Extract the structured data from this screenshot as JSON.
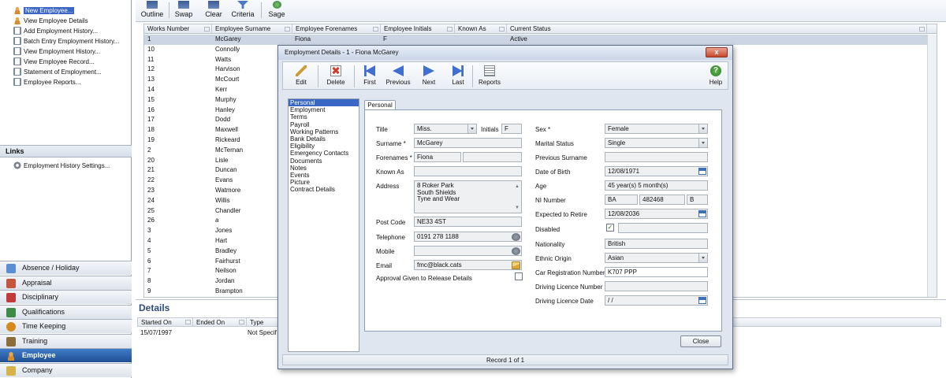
{
  "tasks": [
    "New Employee...",
    "View Employee Details",
    "Add Employment History...",
    "Batch Entry Employment History...",
    "View Employment History...",
    "View Employee Record...",
    "Statement of Employment...",
    "Employee Reports..."
  ],
  "links": {
    "header": "Links",
    "items": [
      "Employment History Settings..."
    ]
  },
  "modules": [
    {
      "label": "Absence / Holiday",
      "color": "#5b8fd1"
    },
    {
      "label": "Appraisal",
      "color": "#c2563e"
    },
    {
      "label": "Disciplinary",
      "color": "#c23b3b"
    },
    {
      "label": "Qualifications",
      "color": "#3f8b46"
    },
    {
      "label": "Time Keeping",
      "color": "#d48a1f"
    },
    {
      "label": "Training",
      "color": "#8c6d3c"
    },
    {
      "label": "Employee",
      "color": "#e8a84a"
    },
    {
      "label": "Company",
      "color": "#d7b14a"
    }
  ],
  "active_module": "Employee",
  "toolbar": {
    "outline": "Outline",
    "swap": "Swap",
    "clear": "Clear",
    "criteria": "Criteria",
    "sage": "Sage"
  },
  "grid": {
    "columns": [
      "Works Number",
      "Employee Surname",
      "Employee Forenames",
      "Employee Initials",
      "Known As",
      "Current Status"
    ],
    "first_row": {
      "number": "1",
      "surname": "McGarey",
      "forenames": "Fiona",
      "initials": "F",
      "status": "Active"
    },
    "rows": [
      [
        "10",
        "Connolly"
      ],
      [
        "11",
        "Watts"
      ],
      [
        "12",
        "Harvison"
      ],
      [
        "13",
        "McCourt"
      ],
      [
        "14",
        "Kerr"
      ],
      [
        "15",
        "Murphy"
      ],
      [
        "16",
        "Hanley"
      ],
      [
        "17",
        "Dodd"
      ],
      [
        "18",
        "Maxwell"
      ],
      [
        "19",
        "Rickeard"
      ],
      [
        "2",
        "McTernan"
      ],
      [
        "20",
        "Lisle"
      ],
      [
        "21",
        "Duncan"
      ],
      [
        "22",
        "Evans"
      ],
      [
        "23",
        "Watmore"
      ],
      [
        "24",
        "Willis"
      ],
      [
        "25",
        "Chandler"
      ],
      [
        "26",
        "a"
      ],
      [
        "3",
        "Jones"
      ],
      [
        "4",
        "Hart"
      ],
      [
        "5",
        "Bradley"
      ],
      [
        "6",
        "Fairhurst"
      ],
      [
        "7",
        "Neilson"
      ],
      [
        "8",
        "Jordan"
      ],
      [
        "9",
        "Brampton"
      ]
    ]
  },
  "details": {
    "title": "Details",
    "columns": [
      "Started On",
      "Ended On",
      "Type"
    ],
    "row": [
      "15/07/1997",
      "",
      "Not Specif"
    ]
  },
  "dialog": {
    "title": "Employment Details - 1 - Fiona McGarey",
    "close_glyph": "x",
    "tools": {
      "edit": "Edit",
      "delete": "Delete",
      "first": "First",
      "previous": "Previous",
      "next": "Next",
      "last": "Last",
      "reports": "Reports",
      "help": "Help"
    },
    "nav": [
      "Personal",
      "Employment",
      "Terms",
      "Payroll",
      "Working Patterns",
      "Bank Details",
      "Eligibility",
      "Emergency Contacts",
      "Documents",
      "Notes",
      "Events",
      "Picture",
      "Contract Details"
    ],
    "tab": "Personal",
    "labels": {
      "title": "Title",
      "initials": "Initials",
      "surname": "Surname *",
      "forenames": "Forenames *",
      "known_as": "Known As",
      "address": "Address",
      "post_code": "Post Code",
      "telephone": "Telephone",
      "mobile": "Mobile",
      "email": "Email",
      "approval": "Approval Given to Release Details",
      "sex": "Sex *",
      "marital_status": "Marital Status",
      "previous_surname": "Previous Surname",
      "dob": "Date of Birth",
      "age": "Age",
      "ni_number": "NI Number",
      "expected_retire": "Expected to Retire",
      "disabled": "Disabled",
      "nationality": "Nationality",
      "ethnic_origin": "Ethnic Origin",
      "car_reg": "Car Registration Number",
      "licence_number": "Driving Licence Number",
      "licence_date": "Driving Licence Date"
    },
    "values": {
      "title": "Miss.",
      "initials": "F",
      "surname": "McGarey",
      "forenames": "Fiona",
      "forenames2": "",
      "known_as": "",
      "address": [
        "8 Roker Park",
        "South Shields",
        "Tyne and Wear"
      ],
      "post_code": "NE33 4ST",
      "telephone": "0191 278 1188",
      "mobile": "",
      "email": "fmc@black.cats",
      "approval": false,
      "sex": "Female",
      "marital_status": "Single",
      "previous_surname": "",
      "dob": "12/08/1971",
      "age": "45 year(s) 5 month(s)",
      "ni_1": "BA",
      "ni_2": "482468",
      "ni_3": "B",
      "expected_retire": "12/08/2036",
      "disabled": true,
      "disabled_text": "",
      "nationality": "British",
      "ethnic_origin": "Asian",
      "car_reg": "K707 PPP",
      "licence_number": "",
      "licence_date": " / /"
    },
    "close_button": "Close",
    "status": "Record 1 of 1"
  }
}
